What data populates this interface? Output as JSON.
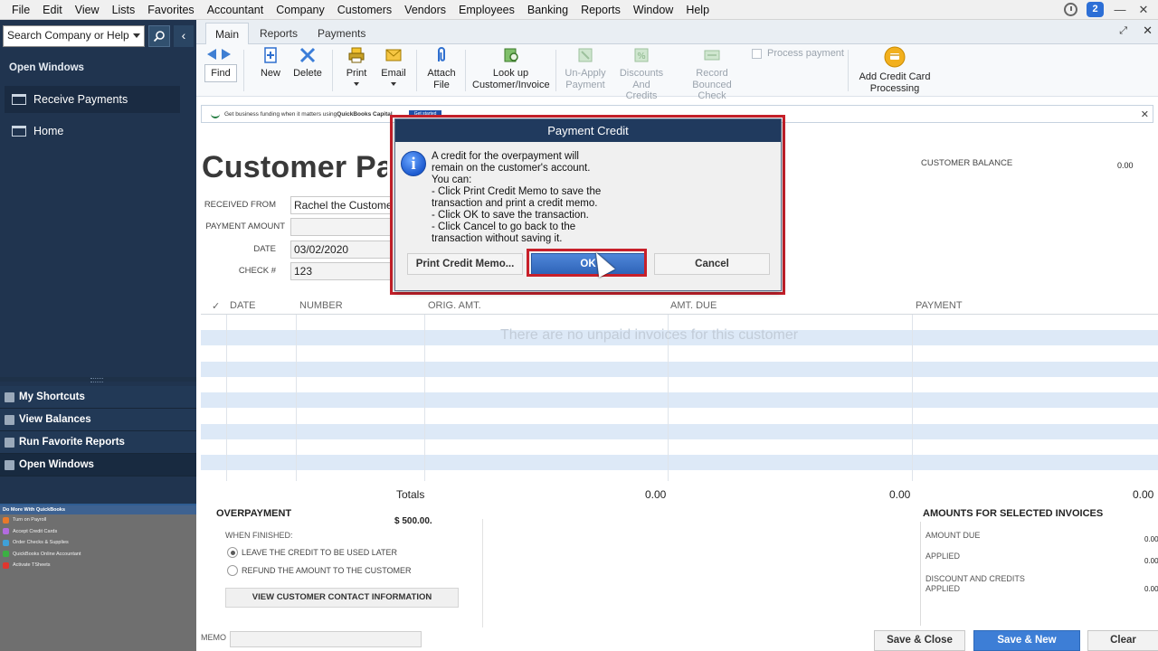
{
  "menu": [
    "File",
    "Edit",
    "View",
    "Lists",
    "Favorites",
    "Accountant",
    "Company",
    "Customers",
    "Vendors",
    "Employees",
    "Banking",
    "Reports",
    "Window",
    "Help"
  ],
  "menu_alerts_count": "2",
  "sidebar": {
    "search_placeholder": "Search Company or Help",
    "heading": "Open Windows",
    "open_windows": [
      "Receive Payments",
      "Home"
    ],
    "sections": [
      "My Shortcuts",
      "View Balances",
      "Run Favorite Reports",
      "Open Windows"
    ],
    "do_more": {
      "title": "Do More With QuickBooks",
      "items": [
        {
          "label": "Turn on Payroll",
          "color": "#e8792b"
        },
        {
          "label": "Accept Credit Cards",
          "color": "#b36be0"
        },
        {
          "label": "Order Checks & Supplies",
          "color": "#3fa0d8"
        },
        {
          "label": "QuickBooks Online Accountant",
          "color": "#3cb043"
        },
        {
          "label": "Activate TSheets",
          "color": "#e0362e"
        }
      ]
    }
  },
  "tabs": [
    "Main",
    "Reports",
    "Payments"
  ],
  "ribbon": {
    "find": "Find",
    "new": "New",
    "delete": "Delete",
    "print": "Print",
    "email": "Email",
    "attach_l1": "Attach",
    "attach_l2": "File",
    "lookup_l1": "Look up",
    "lookup_l2": "Customer/Invoice",
    "unapply_l1": "Un-Apply",
    "unapply_l2": "Payment",
    "discounts_l1": "Discounts And",
    "discounts_l2": "Credits",
    "record_l1": "Record",
    "record_l2": "Bounced Check",
    "process_payment": "Process payment",
    "addcc_l1": "Add Credit Card",
    "addcc_l2": "Processing"
  },
  "banner": {
    "text_a": "Get business funding when it matters using ",
    "text_b": "QuickBooks Capital",
    "button": "Get started"
  },
  "form": {
    "title": "Customer Payment",
    "received_from_label": "RECEIVED FROM",
    "received_from": "Rachel the Customer",
    "payment_amount_label": "PAYMENT AMOUNT",
    "date_label": "DATE",
    "date": "03/02/2020",
    "check_label": "CHECK #",
    "check": "123",
    "customer_balance_label": "CUSTOMER BALANCE",
    "customer_balance": "0.00"
  },
  "table": {
    "check_col": "✓",
    "columns": [
      "DATE",
      "NUMBER",
      "ORIG. AMT.",
      "AMT. DUE",
      "PAYMENT"
    ],
    "empty_message": "There are no unpaid invoices for this customer",
    "totals_label": "Totals",
    "totals": [
      "0.00",
      "0.00",
      "0.00"
    ]
  },
  "overpayment": {
    "title": "OVERPAYMENT",
    "amount": "$ 500.00.",
    "when_finished": "WHEN FINISHED:",
    "option1": "LEAVE THE CREDIT TO BE USED LATER",
    "option2": "REFUND THE AMOUNT TO THE CUSTOMER",
    "contact_btn": "VIEW CUSTOMER CONTACT INFORMATION"
  },
  "amounts": {
    "title": "AMOUNTS FOR SELECTED INVOICES",
    "amount_due_label": "AMOUNT DUE",
    "amount_due": "0.00",
    "applied_label": "APPLIED",
    "applied": "0.00",
    "discount_l1": "DISCOUNT AND CREDITS",
    "discount_l2": "APPLIED",
    "discount": "0.00"
  },
  "footer": {
    "memo_label": "MEMO",
    "save_close": "Save & Close",
    "save_new": "Save & New",
    "clear": "Clear"
  },
  "dialog": {
    "title": "Payment Credit",
    "lines": [
      "A credit for the overpayment will",
      "remain on the customer's account.",
      "You can:",
      "- Click Print Credit Memo to save the",
      "transaction and print a credit memo.",
      "- Click OK to save the transaction.",
      "- Click Cancel to go back to the",
      "transaction without saving it."
    ],
    "print_btn": "Print Credit Memo...",
    "ok_btn": "OK",
    "cancel_btn": "Cancel"
  }
}
